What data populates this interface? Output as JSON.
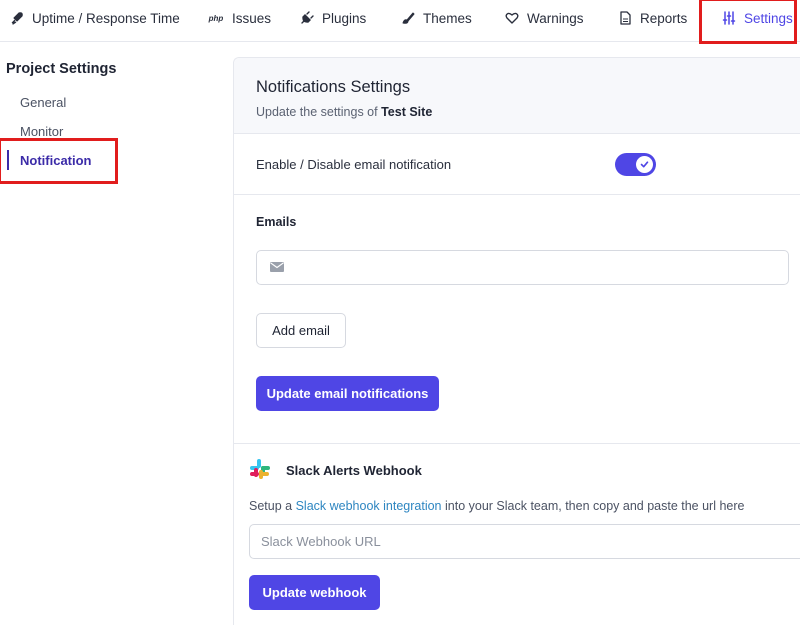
{
  "nav": {
    "tabs": [
      {
        "label": "Uptime / Response Time",
        "icon": "rocket-icon"
      },
      {
        "label": "Issues",
        "icon": "php-icon",
        "icon_text": "php"
      },
      {
        "label": "Plugins",
        "icon": "plug-icon"
      },
      {
        "label": "Themes",
        "icon": "brush-icon"
      },
      {
        "label": "Warnings",
        "icon": "heart-icon"
      },
      {
        "label": "Reports",
        "icon": "document-icon"
      },
      {
        "label": "Settings",
        "icon": "sliders-icon",
        "active": true
      }
    ]
  },
  "sidebar": {
    "title": "Project Settings",
    "items": [
      {
        "label": "General"
      },
      {
        "label": "Monitor"
      },
      {
        "label": "Notification",
        "active": true
      }
    ]
  },
  "panel": {
    "title": "Notifications Settings",
    "subtitle_prefix": "Update the settings of",
    "site_name": "Test Site",
    "toggle_label": "Enable / Disable email notification",
    "toggle_on": true,
    "emails_label": "Emails",
    "email_value": "",
    "add_email_label": "Add email",
    "update_email_label": "Update email notifications",
    "slack": {
      "title": "Slack Alerts Webhook",
      "desc_prefix": "Setup a",
      "link_text": "Slack webhook integration",
      "desc_suffix": "into your Slack team, then copy and paste the url here",
      "placeholder": "Slack Webhook URL",
      "button_label": "Update webhook"
    }
  },
  "colors": {
    "accent": "#4f46e5",
    "highlight": "#e11d1d",
    "link": "#2e86c1"
  }
}
